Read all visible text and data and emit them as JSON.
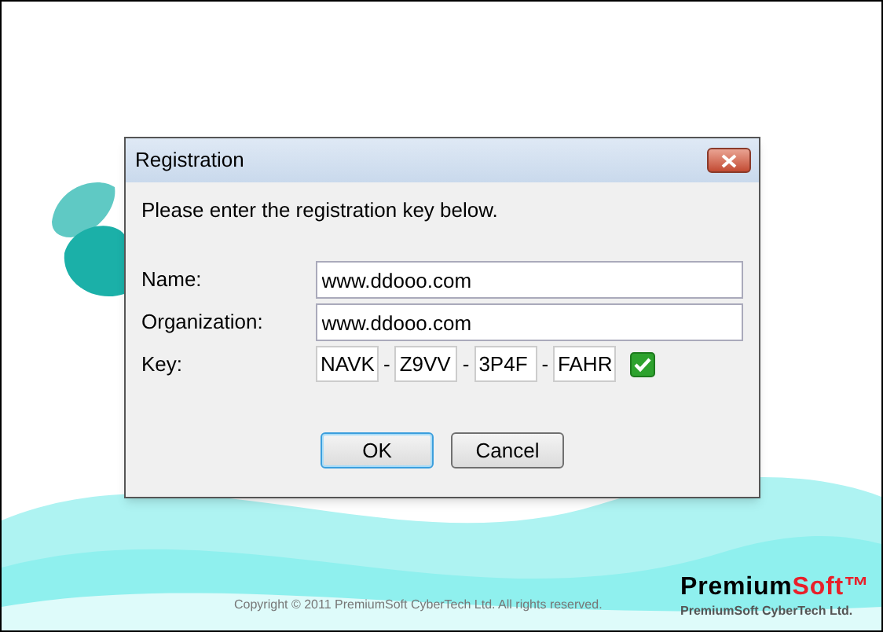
{
  "dialog": {
    "title": "Registration",
    "instruction": "Please enter the registration key below.",
    "fields": [
      {
        "label": "Name:",
        "value": "www.ddooo.com"
      },
      {
        "label": "Organization:",
        "value": "www.ddooo.com"
      }
    ],
    "key": {
      "label": "Key:",
      "parts": [
        "NAVK",
        "Z9VV",
        "3P4F",
        "FAHR"
      ],
      "separator": "-",
      "valid": true
    },
    "buttons": [
      {
        "label": "OK",
        "default": true
      },
      {
        "label": "Cancel",
        "default": false
      }
    ]
  },
  "footer": {
    "copyright": "Copyright © 2011 PremiumSoft CyberTech Ltd. All rights reserved.",
    "brand": "Premium",
    "brand_accent": "Soft™",
    "company": "PremiumSoft CyberTech Ltd."
  }
}
